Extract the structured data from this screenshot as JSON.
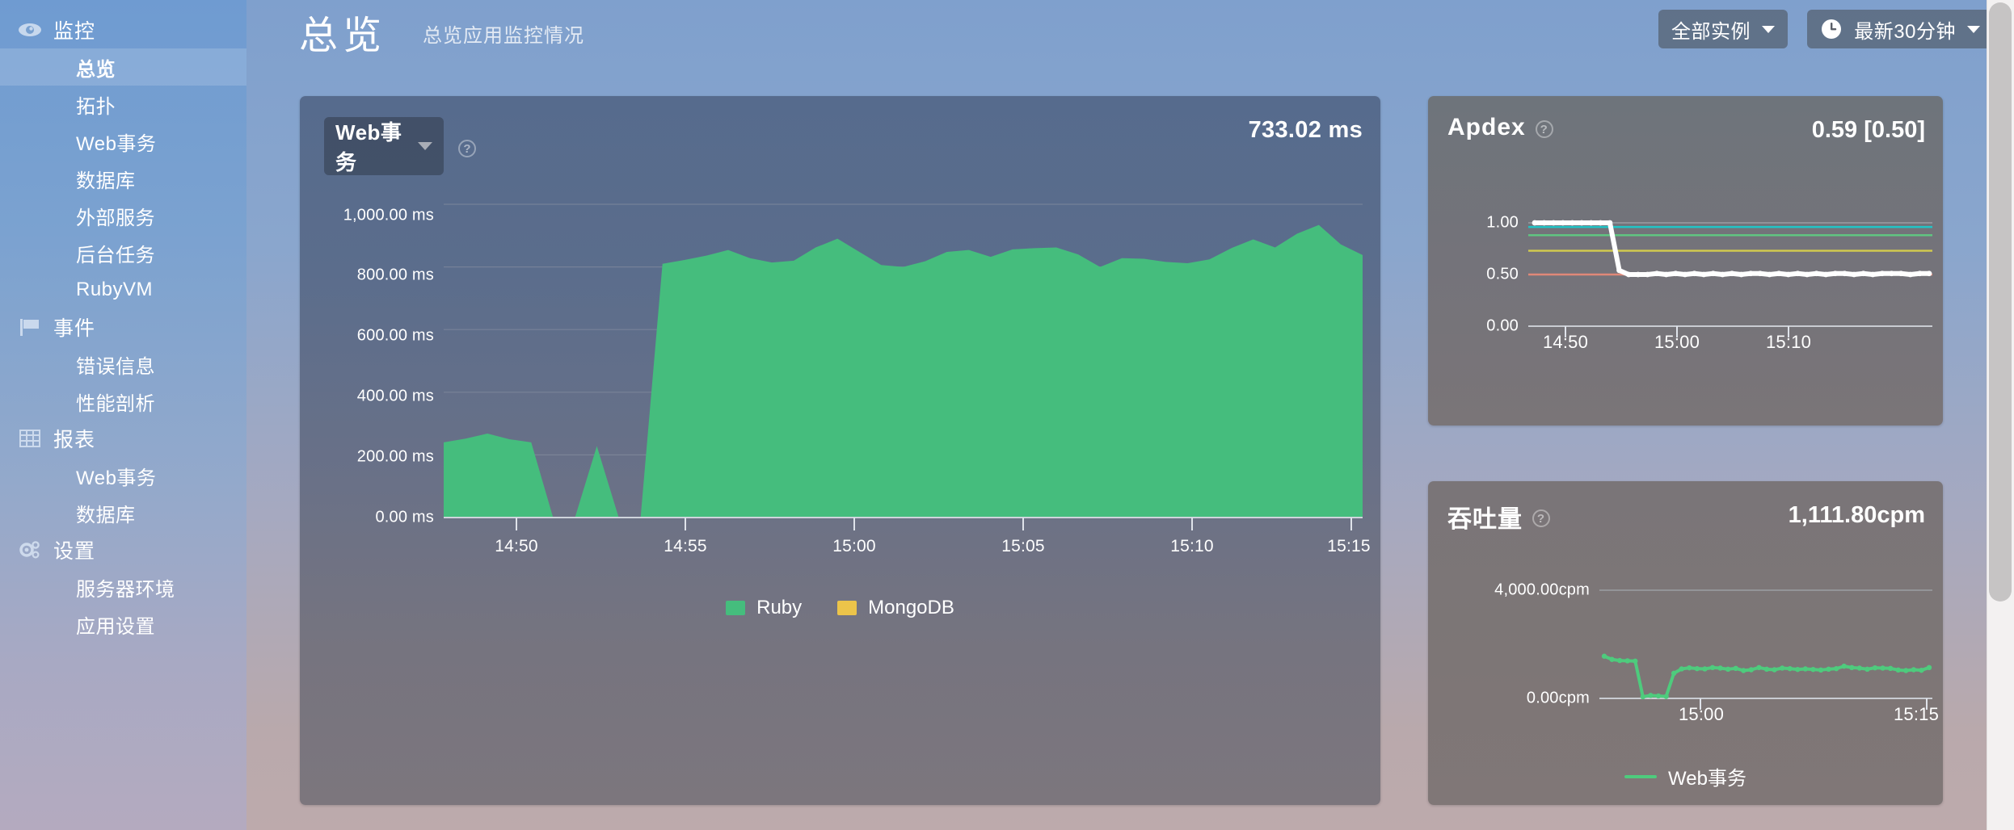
{
  "sidebar": {
    "groups": [
      {
        "label": "监控",
        "icon": "eye-icon",
        "items": [
          {
            "label": "总览",
            "active": true
          },
          {
            "label": "拓扑",
            "active": false
          },
          {
            "label": "Web事务",
            "active": false
          },
          {
            "label": "数据库",
            "active": false
          },
          {
            "label": "外部服务",
            "active": false
          },
          {
            "label": "后台任务",
            "active": false
          },
          {
            "label": "RubyVM",
            "active": false
          }
        ]
      },
      {
        "label": "事件",
        "icon": "flag-icon",
        "items": [
          {
            "label": "错误信息",
            "active": false
          },
          {
            "label": "性能剖析",
            "active": false
          }
        ]
      },
      {
        "label": "报表",
        "icon": "table-icon",
        "items": [
          {
            "label": "Web事务",
            "active": false
          },
          {
            "label": "数据库",
            "active": false
          }
        ]
      },
      {
        "label": "设置",
        "icon": "gears-icon",
        "items": [
          {
            "label": "服务器环境",
            "active": false
          },
          {
            "label": "应用设置",
            "active": false
          }
        ]
      }
    ]
  },
  "header": {
    "title": "总览",
    "subtitle": "总览应用监控情况",
    "instance_filter": "全部实例",
    "time_range": "最新30分钟"
  },
  "main_panel": {
    "dropdown_label": "Web事务",
    "help_glyph": "?",
    "headline_value": "733.02 ms"
  },
  "apdex_panel": {
    "title": "Apdex",
    "help_glyph": "?",
    "headline_value": "0.59 [0.50]"
  },
  "throughput_panel": {
    "title": "吞吐量",
    "help_glyph": "?",
    "headline_value": "1,111.80cpm"
  },
  "colors": {
    "ruby_green": "#45bd7d",
    "mongodb_yellow": "#ecc44a",
    "apdex_line": "#ffffff",
    "threshold_cyan": "#21c4c6",
    "threshold_green": "#5fc882",
    "threshold_yellow": "#d3cc4e",
    "threshold_red": "#e08878",
    "throughput_green": "#4ecb7d",
    "sidebar_blue": "#7ba2d0",
    "panel_slate": "#5b6d8c"
  },
  "chart_data": [
    {
      "id": "response-time",
      "type": "area",
      "title": "Web事务",
      "headline": "733.02 ms",
      "xlabel": "",
      "ylabel": "ms",
      "ylim": [
        0,
        1000
      ],
      "grid": true,
      "legend_position": "bottom",
      "ytick_labels": [
        "0.00 ms",
        "200.00 ms",
        "400.00 ms",
        "600.00 ms",
        "800.00 ms",
        "1,000.00 ms"
      ],
      "yticks": [
        0,
        200,
        400,
        600,
        800,
        1000
      ],
      "xtick_labels": [
        "14:50",
        "14:55",
        "15:00",
        "15:05",
        "15:10",
        "15:15"
      ],
      "xticks": [
        14.5,
        14.55,
        15.0,
        15.05,
        15.1,
        15.15
      ],
      "series": [
        {
          "name": "Ruby",
          "color": "#45bd7d",
          "values": [
            240,
            252,
            268,
            250,
            240,
            0,
            0,
            228,
            0,
            0,
            810,
            822,
            836,
            854,
            828,
            814,
            820,
            862,
            890,
            848,
            806,
            800,
            818,
            848,
            854,
            832,
            856,
            860,
            862,
            840,
            800,
            828,
            826,
            816,
            812,
            824,
            860,
            888,
            862,
            906,
            934,
            872,
            838
          ]
        },
        {
          "name": "MongoDB",
          "color": "#ecc44a",
          "values": [
            0,
            0,
            0,
            0,
            0,
            0,
            0,
            0,
            0,
            0,
            0,
            0,
            0,
            0,
            0,
            0,
            0,
            0,
            0,
            0,
            0,
            0,
            0,
            0,
            0,
            0,
            0,
            0,
            0,
            0,
            0,
            0,
            0,
            0,
            0,
            0,
            0,
            0,
            0,
            0,
            0,
            0,
            0
          ]
        }
      ],
      "legend": [
        "Ruby",
        "MongoDB"
      ]
    },
    {
      "id": "apdex",
      "type": "line",
      "title": "Apdex",
      "headline": "0.59 [0.50]",
      "ylim": [
        0,
        1.0
      ],
      "ytick_labels": [
        "0.00",
        "0.50",
        "1.00"
      ],
      "yticks": [
        0.0,
        0.5,
        1.0
      ],
      "xtick_labels": [
        "14:50",
        "15:00",
        "15:10"
      ],
      "grid": true,
      "threshold_lines": [
        {
          "value": 0.96,
          "color": "#21c4c6"
        },
        {
          "value": 0.88,
          "color": "#5fc882"
        },
        {
          "value": 0.73,
          "color": "#d3cc4e"
        },
        {
          "value": 0.5,
          "color": "#e08878"
        }
      ],
      "series": [
        {
          "name": "Apdex",
          "color": "#ffffff",
          "values": [
            1.0,
            1.0,
            1.0,
            1.0,
            1.0,
            1.0,
            1.0,
            1.0,
            1.0,
            0.54,
            0.5,
            0.5,
            0.5,
            0.51,
            0.5,
            0.51,
            0.5,
            0.51,
            0.5,
            0.51,
            0.5,
            0.51,
            0.5,
            0.51,
            0.51,
            0.5,
            0.51,
            0.5,
            0.51,
            0.5,
            0.51,
            0.5,
            0.51,
            0.51,
            0.5,
            0.51,
            0.5,
            0.51,
            0.51,
            0.51,
            0.5,
            0.51,
            0.51
          ]
        }
      ]
    },
    {
      "id": "throughput",
      "type": "line",
      "title": "吞吐量",
      "headline": "1,111.80cpm",
      "ylim": [
        0,
        4000
      ],
      "ytick_labels": [
        "0.00cpm",
        "4,000.00cpm"
      ],
      "yticks": [
        0,
        4000
      ],
      "xtick_labels": [
        "15:00",
        "15:15"
      ],
      "grid": true,
      "legend": [
        "Web事务"
      ],
      "legend_position": "bottom",
      "series": [
        {
          "name": "Web事务",
          "color": "#4ecb7d",
          "values": [
            1560,
            1440,
            1400,
            1390,
            1380,
            60,
            110,
            90,
            70,
            930,
            1090,
            1130,
            1100,
            1090,
            1140,
            1120,
            1080,
            1110,
            1030,
            1060,
            1140,
            1080,
            1060,
            1120,
            1100,
            1070,
            1090,
            1070,
            1050,
            1080,
            1100,
            1190,
            1140,
            1120,
            1080,
            1130,
            1120,
            1110,
            1050,
            1030,
            1060,
            1040,
            1140
          ]
        }
      ]
    }
  ]
}
